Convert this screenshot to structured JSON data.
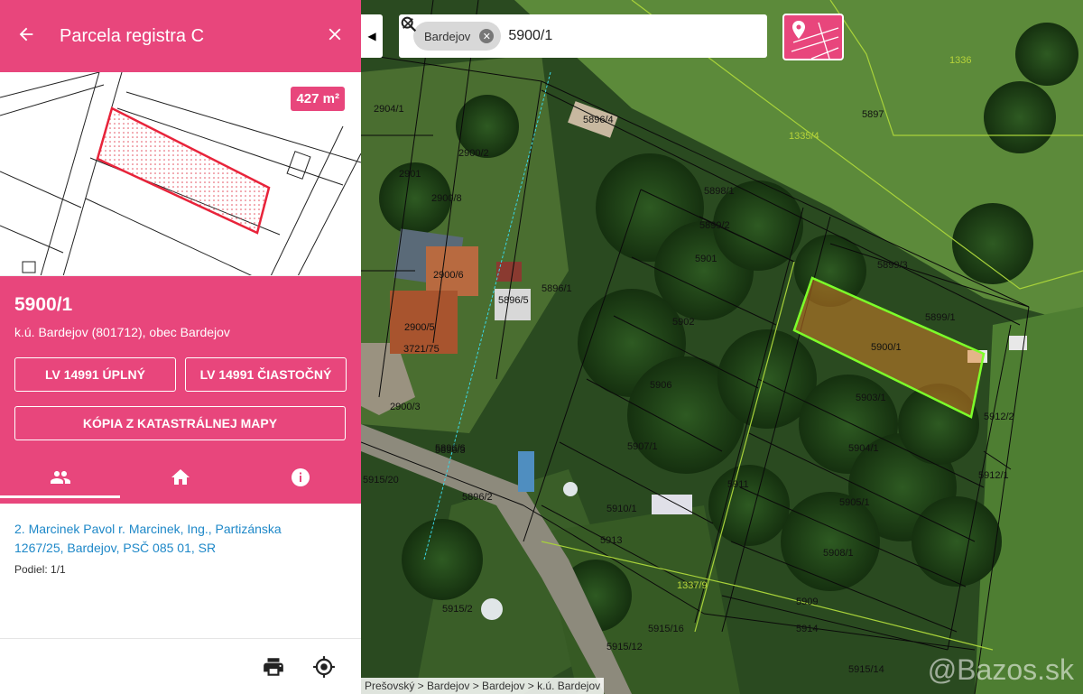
{
  "panel": {
    "title": "Parcela registra C",
    "area": "427 m²",
    "parcel_number": "5900/1",
    "subtitle": "k.ú. Bardejov (801712), obec Bardejov",
    "buttons": {
      "lv_full": "LV 14991 ÚPLNÝ",
      "lv_partial": "LV 14991 ČIASTOČNÝ",
      "map_copy": "KÓPIA Z KATASTRÁLNEJ MAPY"
    },
    "owner": {
      "line1": "2. Marcinek Pavol r. Marcinek, Ing., Partizánska",
      "line2": "1267/25, Bardejov, PSČ 085 01, SR",
      "share": "Podiel: 1/1"
    }
  },
  "search": {
    "chip": "Bardejov",
    "query": "5900/1"
  },
  "map": {
    "breadcrumb": "Prešovský > Bardejov > Bardejov > k.ú. Bardejov",
    "watermark": "@Bazos.sk",
    "labels": [
      "5897",
      "5898/1",
      "5899/2",
      "5899/3",
      "5899/1",
      "5900/1",
      "5901",
      "5902",
      "5903/1",
      "5904/1",
      "5905/1",
      "5906",
      "5907/1",
      "5908/1",
      "5909",
      "5910/1",
      "5911",
      "5912/1",
      "5912/2",
      "5913",
      "5914",
      "5915/2",
      "5915/12",
      "5915/14",
      "5915/16",
      "5915/20",
      "5896/1",
      "5896/2",
      "5896/3",
      "5896/4",
      "5896/5",
      "5896/6",
      "2900/2",
      "2900/3",
      "2900/5",
      "2900/6",
      "2900/8",
      "2901",
      "2904/1",
      "1335/4",
      "1336",
      "1337/9",
      "3721/75"
    ]
  },
  "colors": {
    "accent": "#e8467c",
    "link": "#1e88c8",
    "parcel_outline": "#7dff2a"
  },
  "icons": [
    "back-arrow-icon",
    "close-icon",
    "people-icon",
    "home-icon",
    "info-icon",
    "print-icon",
    "locate-icon",
    "chevron-left-icon",
    "search-icon",
    "clear-icon",
    "layer-parcel-icon"
  ]
}
